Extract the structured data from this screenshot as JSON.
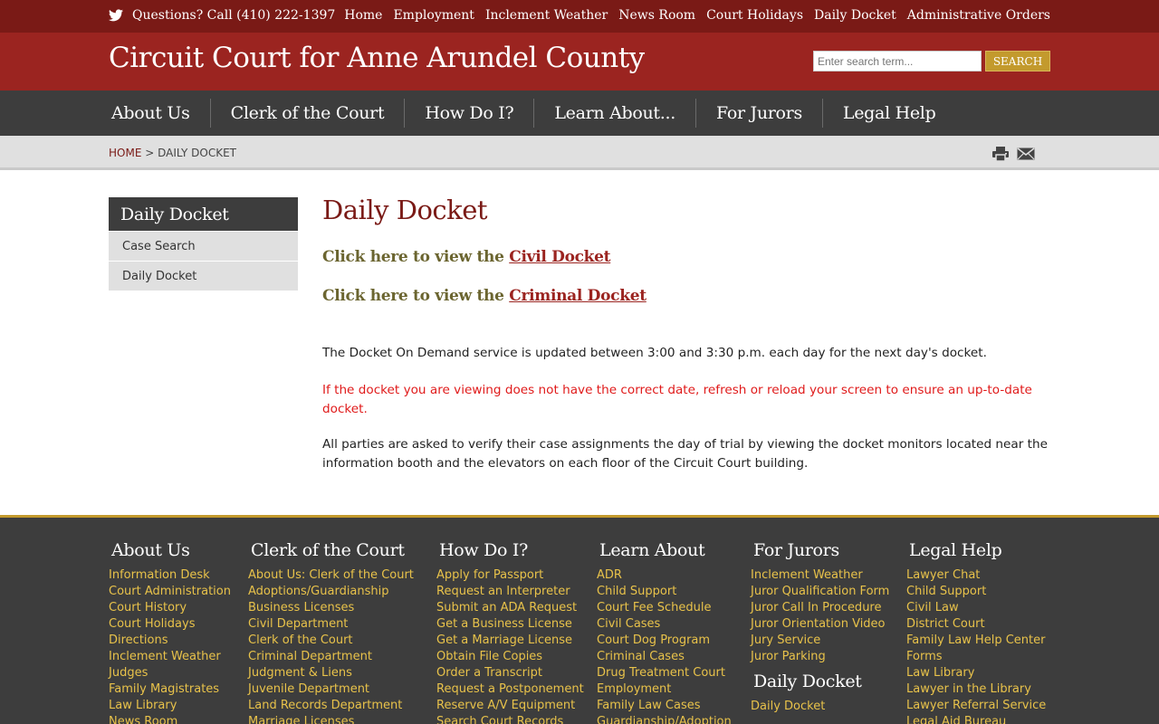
{
  "topbar": {
    "phone_text": "Questions? Call (410) 222-1397",
    "links": [
      "Home",
      "Employment",
      "Inclement Weather",
      "News Room",
      "Court Holidays",
      "Daily Docket",
      "Administrative Orders"
    ]
  },
  "header": {
    "site_title": "Circuit Court for Anne Arundel County",
    "search_placeholder": "Enter search term...",
    "search_button": "SEARCH"
  },
  "mainnav": {
    "items": [
      "About Us",
      "Clerk of the Court",
      "How Do I?",
      "Learn About...",
      "For Jurors",
      "Legal Help"
    ]
  },
  "breadcrumb": {
    "home": "HOME",
    "separator": ">",
    "current": "DAILY DOCKET"
  },
  "sidebar": {
    "title": "Daily Docket",
    "items": [
      "Case Search",
      "Daily Docket"
    ]
  },
  "content": {
    "title": "Daily Docket",
    "civil_prefix": "Click here to view the ",
    "civil_link": "Civil Docket",
    "criminal_prefix": "Click here to view the ",
    "criminal_link": "Criminal Docket",
    "para1": "The Docket On Demand service is updated between 3:00 and 3:30 p.m. each day for the next day's docket.",
    "para2": "If the docket you are viewing does not have the correct date, refresh or reload your screen to ensure an up-to-date docket.",
    "para3": "All parties are asked to verify their case assignments the day of trial by viewing the docket monitors located near the information booth and the elevators on each floor of the Circuit Court building."
  },
  "footer": {
    "about": {
      "title": "About Us",
      "links": [
        "Information Desk",
        "Court Administration",
        "Court History",
        "Court Holidays",
        "Directions",
        "Inclement Weather",
        "Judges",
        "Family Magistrates",
        "Law Library",
        "News Room"
      ]
    },
    "clerk": {
      "title": "Clerk of the Court",
      "links": [
        "About Us: Clerk of the Court",
        "Adoptions/Guardianship",
        "Business Licenses",
        "Civil Department",
        "Clerk of the Court",
        "Criminal Department",
        "Judgment & Liens",
        "Juvenile Department",
        "Land Records Department",
        "Marriage Licenses"
      ]
    },
    "howdoi": {
      "title": "How Do I?",
      "links": [
        "Apply for Passport",
        "Request an Interpreter",
        "Submit an ADA Request",
        "Get a Business License",
        "Get a Marriage License",
        "Obtain File Copies",
        "Order a Transcript",
        "Request a Postponement",
        "Reserve A/V Equipment",
        "Search Court Records"
      ]
    },
    "learn": {
      "title": "Learn About",
      "links": [
        "ADR",
        "Child Support",
        "Court Fee Schedule",
        "Civil Cases",
        "Court Dog Program",
        "Criminal Cases",
        "Drug Treatment Court",
        "Employment",
        "Family Law Cases",
        "Guardianship/Adoption"
      ]
    },
    "jurors": {
      "title": "For Jurors",
      "links": [
        "Inclement Weather",
        "Juror Qualification Form",
        "Juror Call In Procedure",
        "Juror Orientation Video",
        "Jury Service",
        "Juror Parking"
      ]
    },
    "docket": {
      "title": "Daily Docket",
      "links": [
        "Daily Docket"
      ]
    },
    "legal": {
      "title": "Legal Help",
      "links": [
        "Lawyer Chat",
        "Child Support",
        "Civil Law",
        "District Court",
        "Family Law Help Center",
        "Forms",
        "Law Library",
        "Lawyer in the Library",
        "Lawyer Referral Service",
        "Legal Aid Bureau"
      ]
    }
  },
  "colors": {
    "topbar": "#7a1a16",
    "header": "#9b2420",
    "nav": "#3d3d3d",
    "accent_gold": "#c39a2d",
    "footer_link": "#e8c24a",
    "warning_red": "#e01b1b"
  }
}
